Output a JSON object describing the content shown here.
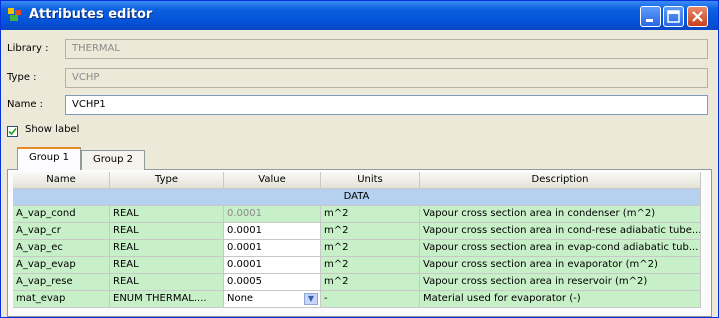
{
  "window": {
    "title": "Attributes editor",
    "title_bar_color": "#0553d8",
    "icons": [
      "app-icon",
      "minimize-icon",
      "maximize-icon",
      "close-icon"
    ]
  },
  "form": {
    "library_label": "Library :",
    "library_value": "THERMAL",
    "type_label": "Type :",
    "type_value": "VCHP",
    "name_label": "Name :",
    "name_value": "VCHP1",
    "show_label_text": "Show label",
    "show_label_checked": true
  },
  "tabs": [
    {
      "label": "Group 1",
      "active": true
    },
    {
      "label": "Group 2",
      "active": false
    }
  ],
  "table": {
    "columns": [
      "Name",
      "Type",
      "Value",
      "Units",
      "Description"
    ],
    "section": "DATA",
    "rows": [
      {
        "name": "A_vap_cond",
        "type": "REAL",
        "value": "0.0001",
        "units": "m^2",
        "description": "Vapour cross section area in condenser (m^2)",
        "disabled": true
      },
      {
        "name": "A_vap_cr",
        "type": "REAL",
        "value": "0.0001",
        "units": "m^2",
        "description": "Vapour cross section area in cond-rese adiabatic tube...",
        "disabled": false
      },
      {
        "name": "A_vap_ec",
        "type": "REAL",
        "value": "0.0001",
        "units": "m^2",
        "description": "Vapour cross section area in evap-cond adiabatic tub...",
        "disabled": false
      },
      {
        "name": "A_vap_evap",
        "type": "REAL",
        "value": "0.0001",
        "units": "m^2",
        "description": "Vapour cross section area in evaporator (m^2)",
        "disabled": false
      },
      {
        "name": "A_vap_rese",
        "type": "REAL",
        "value": "0.0005",
        "units": "m^2",
        "description": "Vapour cross section area in reservoir (m^2)",
        "disabled": false
      },
      {
        "name": "mat_evap",
        "type": "ENUM THERMAL....",
        "value": "None",
        "units": "-",
        "description": "Material used for evaporator (-)",
        "disabled": false,
        "combo": true
      }
    ],
    "row_color": "#c8f0c8",
    "section_color": "#b6d0f0"
  }
}
